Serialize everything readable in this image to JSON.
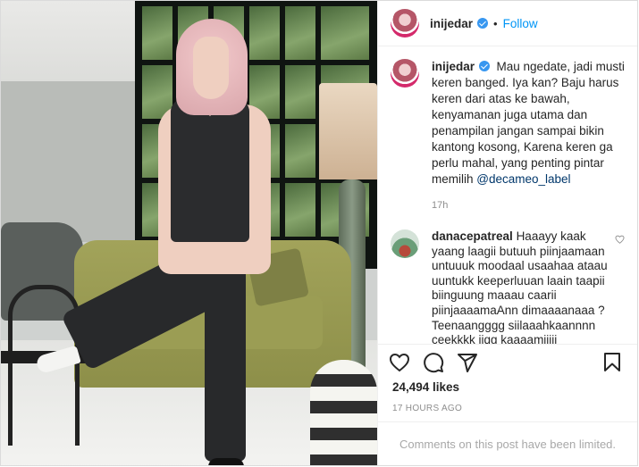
{
  "post": {
    "username": "inijedar",
    "follow_label": "Follow",
    "separator": "•",
    "caption_text": "Mau ngedate, jadi musti keren banged. Iya kan? Baju harus keren dari atas ke bawah, kenyamanan juga utama dan penampilan jangan sampai bikin kantong kosong, Karena keren ga perlu mahal, yang penting pintar memilih ",
    "caption_mention": "@decameo_label",
    "caption_time": "17h",
    "likes": "24,494 likes",
    "posted_ago": "17 HOURS AGO",
    "comments_notice": "Comments on this post have been limited."
  },
  "comment": {
    "username": "danacepatreal",
    "text": "Haaayy kaak yaang laagii butuuh piinjaamaan untuuuk moodaal usaahaa ataau uuntukk keeperluuan laain taapii biinguung maaau caarii piinjaaaamaAnn dimaaaanaaa ? Teenaangggg siilaaahkaannnn ceekkkk iiqg kaaaamiiiii"
  },
  "icons": {
    "verified": "verified-badge-icon",
    "like": "heart-icon",
    "comment": "comment-icon",
    "share": "share-icon",
    "save": "bookmark-icon",
    "comment_like": "heart-small-icon"
  },
  "colors": {
    "link": "#0095f6",
    "verified": "#3897f0",
    "muted": "#8e8e8e"
  }
}
